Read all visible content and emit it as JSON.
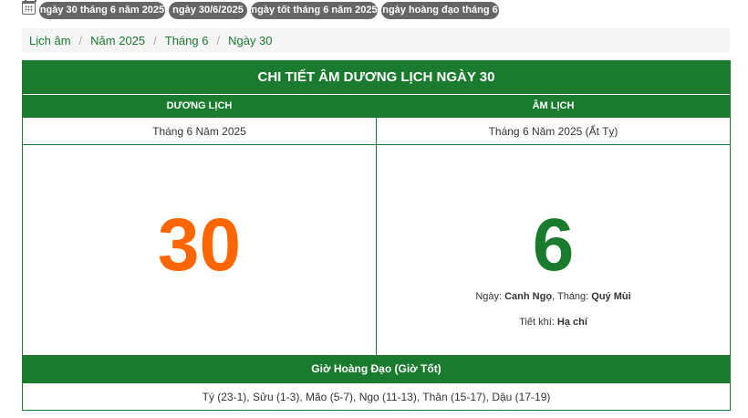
{
  "tags": [
    "ngày 30 tháng 6 năm 2025",
    "ngày 30/6/2025",
    "ngày tốt tháng 6 năm 2025",
    "ngày hoàng đạo tháng 6"
  ],
  "breadcrumb": [
    "Lịch âm",
    "Năm 2025",
    "Tháng 6",
    "Ngày 30"
  ],
  "breadcrumb_separator": "/",
  "panel": {
    "title": "CHI TIẾT ÂM DƯƠNG LỊCH NGÀY 30",
    "solar": {
      "heading": "DƯƠNG LỊCH",
      "month_year": "Tháng 6 Năm 2025",
      "day": "30"
    },
    "lunar": {
      "heading": "ÂM LỊCH",
      "month_year": "Tháng 6 Năm 2025 (Ất Tỵ)",
      "day": "6",
      "day_label": "Ngày: ",
      "day_canchi": "Canh Ngọ",
      "month_label": ", Tháng: ",
      "month_canchi": "Quý Mùi",
      "solar_term_label": "Tiết khí: ",
      "solar_term": "Hạ chí"
    },
    "good_hours_heading": "Giờ Hoàng Đạo (Giờ Tốt)",
    "good_hours": "Tý (23-1), Sửu (1-3), Mão (5-7), Ngọ (11-13), Thân (15-17), Dậu (17-19)"
  },
  "colors": {
    "primary_green": "#1a7a2e",
    "solar_day": "#ff6600",
    "tag_bg": "#666666"
  },
  "icons": {
    "tag_bar": "calendar-icon"
  }
}
